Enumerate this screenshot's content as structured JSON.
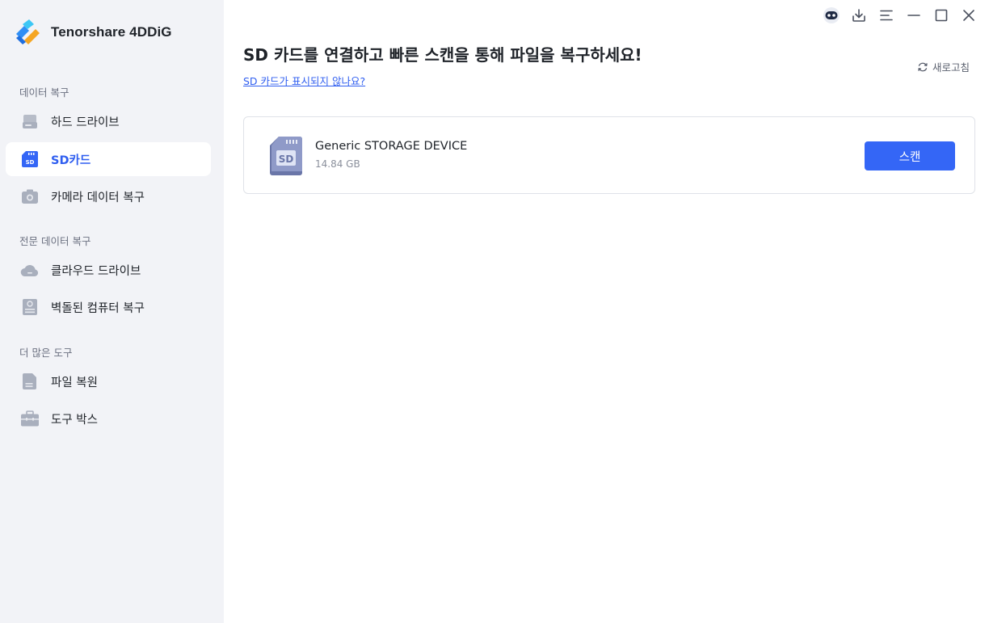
{
  "app": {
    "name": "Tenorshare 4DDiG"
  },
  "sidebar": {
    "sections": [
      {
        "label": "데이터 복구",
        "items": [
          {
            "label": "하드 드라이브",
            "icon": "hard-drive-icon"
          },
          {
            "label": "SD카드",
            "icon": "sd-card-icon",
            "active": true
          },
          {
            "label": "카메라 데이터 복구",
            "icon": "camera-icon"
          }
        ]
      },
      {
        "label": "전문 데이터 복구",
        "items": [
          {
            "label": "클라우드 드라이브",
            "icon": "cloud-icon"
          },
          {
            "label": "벽돌된 컴퓨터 복구",
            "icon": "crashed-computer-icon"
          }
        ]
      },
      {
        "label": "더 많은 도구",
        "items": [
          {
            "label": "파일 복원",
            "icon": "file-icon"
          },
          {
            "label": "도구 박스",
            "icon": "toolbox-icon"
          }
        ]
      }
    ]
  },
  "window_controls": [
    "assistant-bot-icon",
    "download-icon",
    "menu-icon",
    "minimize-icon",
    "maximize-icon",
    "close-icon"
  ],
  "main": {
    "headline": "SD 카드를 연결하고 빠른 스캔을 통해 파일을 복구하세요!",
    "help_link": "SD 카드가 표시되지 않나요?",
    "refresh_label": "새로고침",
    "devices": [
      {
        "name": "Generic STORAGE DEVICE",
        "size": "14.84 GB",
        "action": "스캔"
      }
    ]
  },
  "colors": {
    "accent": "#3466f6",
    "sidebar_bg": "#f2f3f7",
    "active_text": "#2f5ef0",
    "icon_gray": "#a9afbd"
  }
}
